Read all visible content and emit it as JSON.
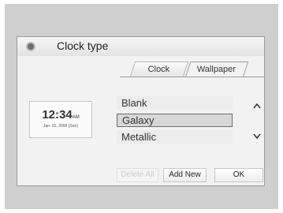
{
  "header": {
    "title": "Clock type",
    "icon": "settings-icon"
  },
  "tabs": [
    {
      "label": "Clock",
      "active": false
    },
    {
      "label": "Wallpaper",
      "active": true
    }
  ],
  "preview": {
    "time": "12:34",
    "ampm": "AM",
    "date": "Jan. 01, 2000 (Sun)"
  },
  "list": {
    "items": [
      "Blank",
      "Galaxy",
      "Metallic"
    ],
    "selected": "Galaxy"
  },
  "scroll": {
    "up": "⌃",
    "down": "⌄"
  },
  "buttons": {
    "delete_all": "Delete All",
    "add_new": "Add New",
    "ok": "OK"
  }
}
